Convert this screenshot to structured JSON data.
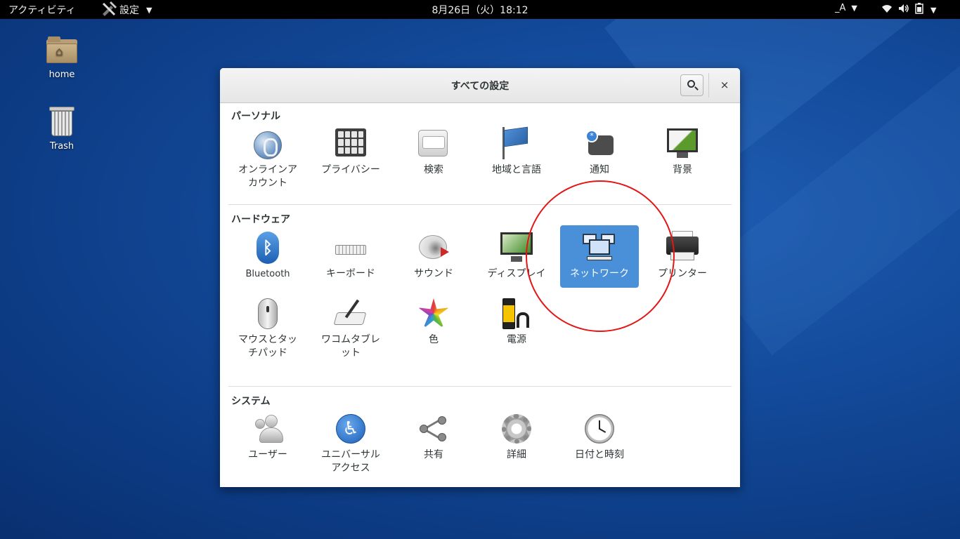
{
  "topbar": {
    "activities": "アクティビティ",
    "app_label": "設定",
    "app_arrow": "▼",
    "clock": "8月26日（火）18:12",
    "ime_label": "_A",
    "ime_arrow": "▼",
    "sys_arrow": "▼"
  },
  "desktop": {
    "home_label": "home",
    "trash_label": "Trash"
  },
  "window": {
    "title": "すべての設定",
    "close_glyph": "×"
  },
  "sections": {
    "personal": {
      "title": "パーソナル",
      "items": [
        {
          "label": "オンラインア\nカウント"
        },
        {
          "label": "プライバシー"
        },
        {
          "label": "検索"
        },
        {
          "label": "地域と言語"
        },
        {
          "label": "通知"
        },
        {
          "label": "背景"
        }
      ]
    },
    "hardware": {
      "title": "ハードウェア",
      "items": [
        {
          "label": "Bluetooth"
        },
        {
          "label": "キーボード"
        },
        {
          "label": "サウンド"
        },
        {
          "label": "ディスプレイ"
        },
        {
          "label": "ネットワーク",
          "selected": true
        },
        {
          "label": "プリンター"
        },
        {
          "label": "マウスとタッ\nチパッド"
        },
        {
          "label": "ワコムタブレ\nット"
        },
        {
          "label": "色"
        },
        {
          "label": "電源"
        }
      ]
    },
    "system": {
      "title": "システム",
      "items": [
        {
          "label": "ユーザー"
        },
        {
          "label": "ユニバーサル\nアクセス"
        },
        {
          "label": "共有"
        },
        {
          "label": "詳細"
        },
        {
          "label": "日付と時刻"
        }
      ]
    }
  },
  "colors": {
    "selection": "#4a90d9",
    "annotation": "#e31616",
    "topbar": "#000000"
  }
}
